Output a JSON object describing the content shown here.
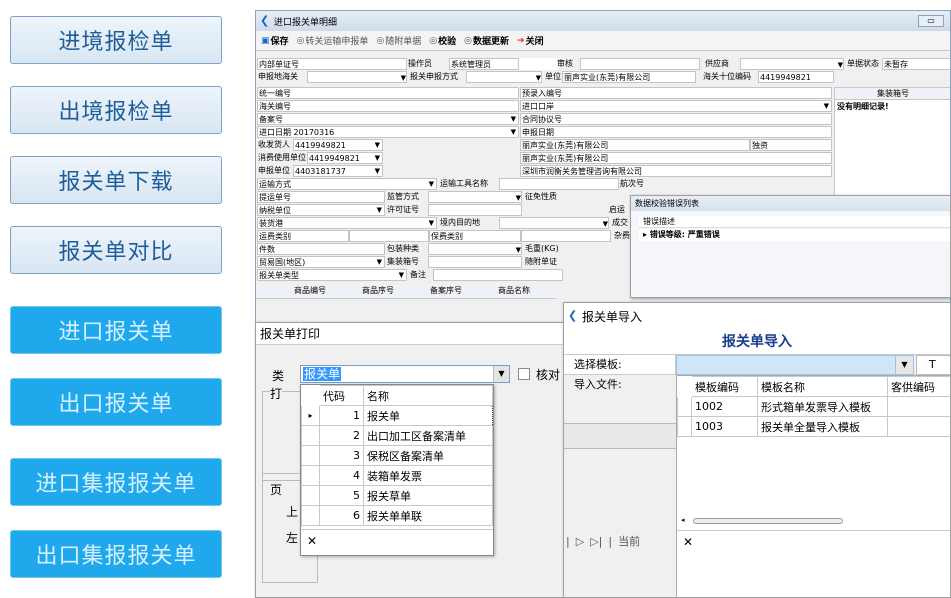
{
  "sidebar": {
    "items": [
      "进境报检单",
      "出境报检单",
      "报关单下载",
      "报关单对比",
      "进口报关单",
      "出口报关单",
      "进口集报报关单",
      "出口集报报关单"
    ]
  },
  "detail_window": {
    "title": "进口报关单明细",
    "toolbar": {
      "save": "保存",
      "transfer": "转关运输申报单",
      "attached": "随附单据",
      "verify": "校验",
      "data_update": "数据更新",
      "close": "关闭"
    },
    "form": {
      "pre_entry_no_label": "内部单证号",
      "operator_label": "操作员",
      "operator_value": "系统管理员",
      "review_label": "审核",
      "supplier_label": "供应商",
      "declare_customs_label": "申报地海关",
      "declare_method_label": "报关申报方式",
      "unit_label": "单位",
      "unit_value": "丽声实业(东莞)有限公司",
      "customs10_label": "海关十位编码",
      "customs10_value": "4419949821",
      "doc_status_label": "单据状态",
      "doc_status_value": "未暂存",
      "unified_no_label": "统一编号",
      "pre_record_label": "预录入编号",
      "customs_no_label": "海关编号",
      "import_port_label": "进口口岸",
      "record_no_label": "备案号",
      "contract_label": "合同协议号",
      "import_date_label": "进口日期",
      "import_date_value": "20170316",
      "declare_date_label": "申报日期",
      "consignee_label": "收发货人",
      "consignee_code": "4419949821",
      "consignee_name": "丽声实业(东莞)有限公司",
      "consignee_type": "独资",
      "consumer_label": "消费使用单位",
      "consumer_code": "4419949821",
      "consumer_name": "丽声实业(东莞)有限公司",
      "agent_label": "申报单位",
      "agent_code": "4403181737",
      "agent_name": "深圳市润衡关务管理咨询有限公司",
      "transport_label": "运输方式",
      "vehicle_label": "运输工具名称",
      "voyage_label": "航次号",
      "bill_label": "提运单号",
      "supervision_label": "监管方式",
      "tax_nature_label": "征免性质",
      "tax_unit_label": "纳税单位",
      "license_label": "许可证号",
      "port_start_label": "启运",
      "loading_port_label": "装货港",
      "dest_label": "境内目的地",
      "deal_label": "成交",
      "freight_label": "运费类别",
      "insurance_label": "保费类别",
      "misc_label": "杂费",
      "pieces_label": "件数",
      "pack_label": "包装种类",
      "gross_label": "毛重(KG)",
      "trade_country_label": "贸易国(地区)",
      "container_no_label": "集装箱号",
      "attached_doc_label": "随附单证",
      "note_label": "备注",
      "decl_type_label": "报关单类型",
      "goods_headers": [
        "商品编号",
        "商品序号",
        "备案序号",
        "商品名称"
      ],
      "container_header": "集装箱号",
      "no_detail": "没有明细记录!"
    }
  },
  "error_window": {
    "title": "数据校验错误列表",
    "col_header": "错误描述",
    "group_row": "错误等级: 严重错误"
  },
  "print_window": {
    "title": "报关单打印",
    "type_label": "类",
    "type_value": "报关单",
    "check_label": "核对",
    "print_label": "打",
    "page_label": "页",
    "up_label": "上",
    "left_label": "左",
    "dropdown_headers": [
      "代码",
      "名称"
    ],
    "dropdown_rows": [
      {
        "code": "1",
        "name": "报关单"
      },
      {
        "code": "2",
        "name": "出口加工区备案清单"
      },
      {
        "code": "3",
        "name": "保税区备案清单"
      },
      {
        "code": "4",
        "name": "装箱单发票"
      },
      {
        "code": "5",
        "name": "报关草单"
      },
      {
        "code": "6",
        "name": "报关单单联"
      }
    ],
    "close_x": "✕"
  },
  "import_window": {
    "title": "报关单导入",
    "heading": "报关单导入",
    "template_label": "选择模板:",
    "file_label": "导入文件:",
    "btn_partial": "T",
    "table_headers": [
      "模板编码",
      "模板名称",
      "客供编码"
    ],
    "rows": [
      {
        "code": "1002",
        "name": "形式箱单发票导入模板"
      },
      {
        "code": "1003",
        "name": "报关单全量导入模板"
      }
    ],
    "pager": "当前",
    "close_x": "✕"
  }
}
